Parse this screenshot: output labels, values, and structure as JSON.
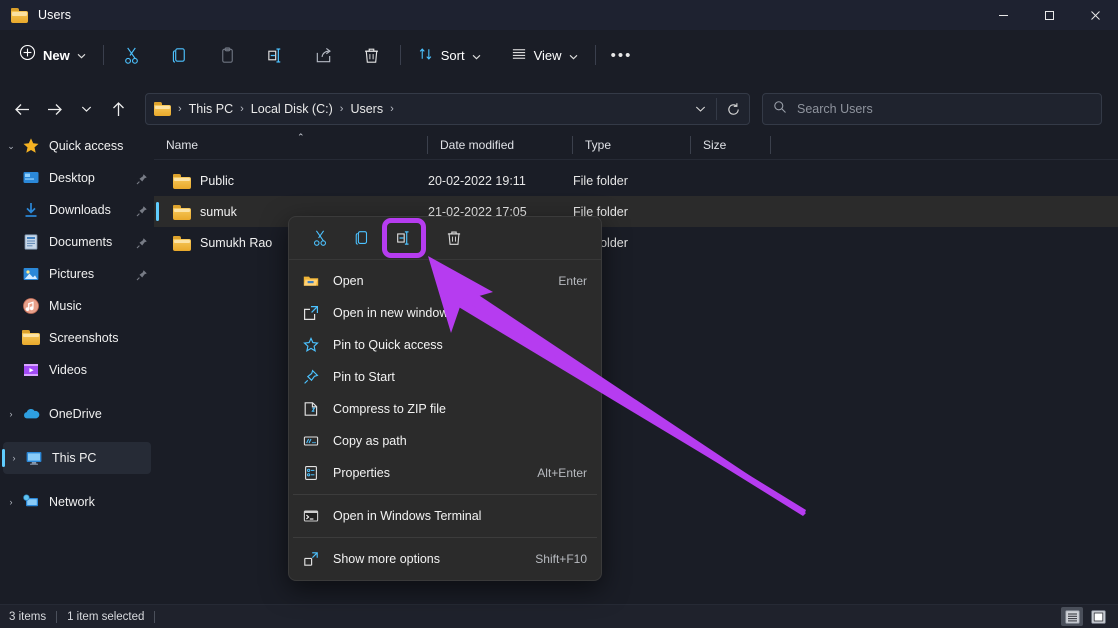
{
  "window": {
    "title": "Users",
    "folder_icon": "folder-icon",
    "minimize_label": "—",
    "maximize_label": "□",
    "close_label": "✕"
  },
  "toolbar": {
    "new_label": "New",
    "new_icon": "plus-circle-icon",
    "new_chevron": "⌄",
    "items": [
      {
        "name": "cut",
        "icon": "scissors-icon",
        "label": "Cut",
        "enabled": true
      },
      {
        "name": "copy",
        "icon": "copy-icon",
        "label": "Copy",
        "enabled": true
      },
      {
        "name": "paste",
        "icon": "paste-icon",
        "label": "Paste",
        "enabled": false
      },
      {
        "name": "rename",
        "icon": "rename-icon",
        "label": "Rename",
        "enabled": true
      },
      {
        "name": "share",
        "icon": "share-icon",
        "label": "Share",
        "enabled": true
      },
      {
        "name": "delete",
        "icon": "trash-icon",
        "label": "Delete",
        "enabled": true
      }
    ],
    "sort_label": "Sort",
    "sort_icon": "sort-arrows-icon",
    "view_label": "View",
    "view_icon": "lines-icon",
    "more_label": "•••"
  },
  "nav": {
    "back_icon": "arrow-left-icon",
    "forward_icon": "arrow-right-icon",
    "recent_icon": "chevron-down-icon",
    "up_icon": "arrow-up-icon",
    "address_folder_icon": "folder-icon",
    "breadcrumbs": [
      "This PC",
      "Local Disk (C:)",
      "Users"
    ],
    "breadcrumb_separator": "›",
    "dropdown_icon": "chevron-down-icon",
    "refresh_icon": "refresh-icon"
  },
  "search": {
    "icon": "search-icon",
    "placeholder": "Search Users",
    "value": ""
  },
  "sidebar": {
    "groups": [
      {
        "name": "quick-access",
        "label": "Quick access",
        "icon": "star-icon",
        "expanded": true,
        "chevron": "⌄",
        "children": [
          {
            "label": "Desktop",
            "icon": "desktop-icon",
            "pinned": true
          },
          {
            "label": "Downloads",
            "icon": "download-icon",
            "pinned": true
          },
          {
            "label": "Documents",
            "icon": "documents-icon",
            "pinned": true
          },
          {
            "label": "Pictures",
            "icon": "pictures-icon",
            "pinned": true
          },
          {
            "label": "Music",
            "icon": "music-icon",
            "pinned": false
          },
          {
            "label": "Screenshots",
            "icon": "folder-icon",
            "pinned": false
          },
          {
            "label": "Videos",
            "icon": "video-icon",
            "pinned": false
          }
        ]
      },
      {
        "name": "onedrive",
        "label": "OneDrive",
        "icon": "cloud-icon",
        "chevron": "›",
        "expanded": false,
        "selected": false,
        "children": []
      },
      {
        "name": "this-pc",
        "label": "This PC",
        "icon": "monitor-icon",
        "chevron": "›",
        "expanded": false,
        "selected": true,
        "children": []
      },
      {
        "name": "network",
        "label": "Network",
        "icon": "network-icon",
        "chevron": "›",
        "expanded": false,
        "selected": false,
        "children": []
      }
    ]
  },
  "filelist": {
    "columns": [
      {
        "label": "Name",
        "sorted": "asc",
        "sort_caret": "⌃"
      },
      {
        "label": "Date modified",
        "sorted": ""
      },
      {
        "label": "Type",
        "sorted": ""
      },
      {
        "label": "Size",
        "sorted": ""
      }
    ],
    "rows": [
      {
        "name": "Public",
        "icon": "folder-icon",
        "date": "20-02-2022 19:11",
        "type": "File folder",
        "size": "",
        "selected": false
      },
      {
        "name": "sumuk",
        "icon": "folder-icon",
        "date": "21-02-2022 17:05",
        "type": "File folder",
        "size": "",
        "selected": true
      },
      {
        "name": "Sumukh Rao",
        "icon": "folder-icon",
        "date": "",
        "type": "File folder",
        "size": "",
        "selected": false
      }
    ]
  },
  "context_menu": {
    "top_actions": [
      {
        "name": "cut",
        "icon": "scissors-icon",
        "label": "Cut",
        "highlighted": false
      },
      {
        "name": "copy",
        "icon": "copy-icon",
        "label": "Copy",
        "highlighted": false
      },
      {
        "name": "rename",
        "icon": "rename-icon",
        "label": "Rename",
        "highlighted": true
      },
      {
        "name": "delete",
        "icon": "trash-icon",
        "label": "Delete",
        "highlighted": false
      }
    ],
    "items": [
      {
        "label": "Open",
        "icon": "open-folder-icon",
        "accel": "Enter",
        "divider_after": false
      },
      {
        "label": "Open in new window",
        "icon": "new-window-icon",
        "accel": "",
        "divider_after": false
      },
      {
        "label": "Pin to Quick access",
        "icon": "star-outline-icon",
        "accel": "",
        "divider_after": false
      },
      {
        "label": "Pin to Start",
        "icon": "pin-icon",
        "accel": "",
        "divider_after": false
      },
      {
        "label": "Compress to ZIP file",
        "icon": "zip-icon",
        "accel": "",
        "divider_after": false
      },
      {
        "label": "Copy as path",
        "icon": "copy-path-icon",
        "accel": "",
        "divider_after": false
      },
      {
        "label": "Properties",
        "icon": "properties-icon",
        "accel": "Alt+Enter",
        "divider_after": true
      },
      {
        "label": "Open in Windows Terminal",
        "icon": "terminal-icon",
        "accel": "",
        "divider_after": true
      },
      {
        "label": "Show more options",
        "icon": "more-options-icon",
        "accel": "Shift+F10",
        "divider_after": false
      }
    ]
  },
  "statusbar": {
    "item_count": "3 items",
    "selection": "1 item selected",
    "details_view_label": "Details view",
    "large_icons_view_label": "Large icons view"
  },
  "annotation": {
    "color": "#b63cf0",
    "highlight_target": "rename-button-in-context-menu"
  }
}
